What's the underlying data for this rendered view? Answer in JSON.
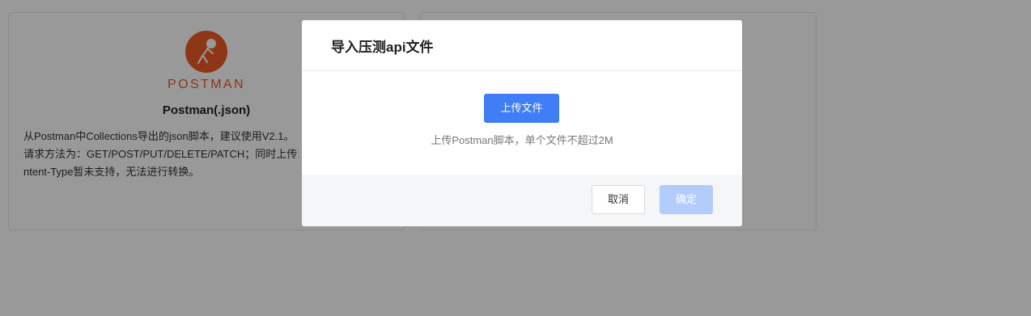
{
  "background_cards": [
    {
      "logo_text": "POSTMAN",
      "title": "Postman(.json)",
      "description_lines": [
        "从Postman中Collections导出的json脚本，建议使用V2.1。",
        "请求方法为：GET/POST/PUT/DELETE/PATCH；同时上传",
        "ntent-Type暂未支持，无法进行转换。"
      ]
    }
  ],
  "modal": {
    "title": "导入压测api文件",
    "upload_button_label": "上传文件",
    "upload_hint": "上传Postman脚本，单个文件不超过2M",
    "cancel_label": "取消",
    "confirm_label": "确定"
  },
  "colors": {
    "postman_orange": "#ef5b25",
    "primary_blue": "#3f7ef6",
    "disabled_blue": "#b3cdfb",
    "overlay": "rgba(0,0,0,0.4)"
  },
  "icons": {
    "postman_logo": "postman-logo-icon"
  }
}
